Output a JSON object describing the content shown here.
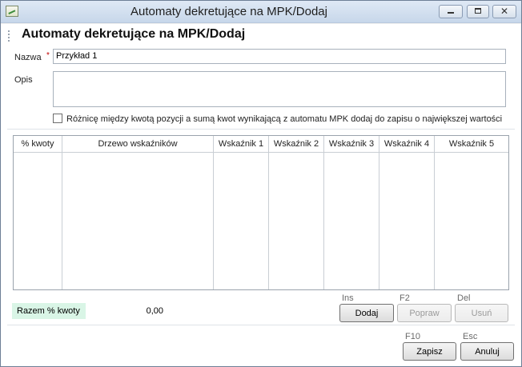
{
  "window": {
    "title": "Automaty dekretujące na MPK/Dodaj"
  },
  "form": {
    "heading": "Automaty dekretujące na MPK/Dodaj",
    "nazwa_label": "Nazwa",
    "required_mark": "*",
    "nazwa_value": "Przykład 1",
    "opis_label": "Opis",
    "opis_value": "",
    "checkbox_label": "Różnicę między kwotą pozycji a sumą kwot wynikającą z automatu MPK dodaj do zapisu o największej wartości",
    "checkbox_checked": false
  },
  "grid": {
    "columns": [
      "% kwoty",
      "Drzewo wskaźników",
      "Wskaźnik 1",
      "Wskaźnik 2",
      "Wskaźnik 3",
      "Wskaźnik 4",
      "Wskaźnik 5"
    ],
    "rows": []
  },
  "summary": {
    "label": "Razem % kwoty",
    "value": "0,00"
  },
  "grid_actions": {
    "add_hint": "Ins",
    "add_label": "Dodaj",
    "edit_hint": "F2",
    "edit_label": "Popraw",
    "delete_hint": "Del",
    "delete_label": "Usuń"
  },
  "dialog_actions": {
    "save_hint": "F10",
    "save_label": "Zapisz",
    "cancel_hint": "Esc",
    "cancel_label": "Anuluj"
  },
  "icons": {
    "app": "chart-app-icon",
    "minimize": "minimize-icon",
    "maximize": "maximize-icon",
    "close": "close-icon"
  }
}
